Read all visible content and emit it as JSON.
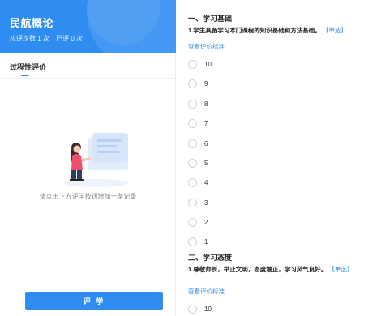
{
  "course": {
    "title": "民航概论",
    "should_evaluate": "应评次数 1 次",
    "evaluated": "已评 0 次"
  },
  "left": {
    "section_title": "过程性评价",
    "empty_text": "请点击下方评学按钮增加一条记录",
    "evaluate_button": "评 学"
  },
  "sections": [
    {
      "title": "一、学习基础",
      "question": "1.学生具备学习本门课程的知识基础和方法基础。",
      "tag": "【单选】",
      "criteria_link": "查看评价标准",
      "options": [
        "10",
        "9",
        "8",
        "7",
        "6",
        "5",
        "4",
        "3",
        "2",
        "1"
      ]
    },
    {
      "title": "二、学习态度",
      "question": "1.尊敬师长，举止文明，态度端正，学习风气良好。",
      "tag": "【单选】",
      "criteria_link": "查看评价标准",
      "options": [
        "10"
      ]
    }
  ],
  "colors": {
    "accent": "#2f8df2"
  }
}
